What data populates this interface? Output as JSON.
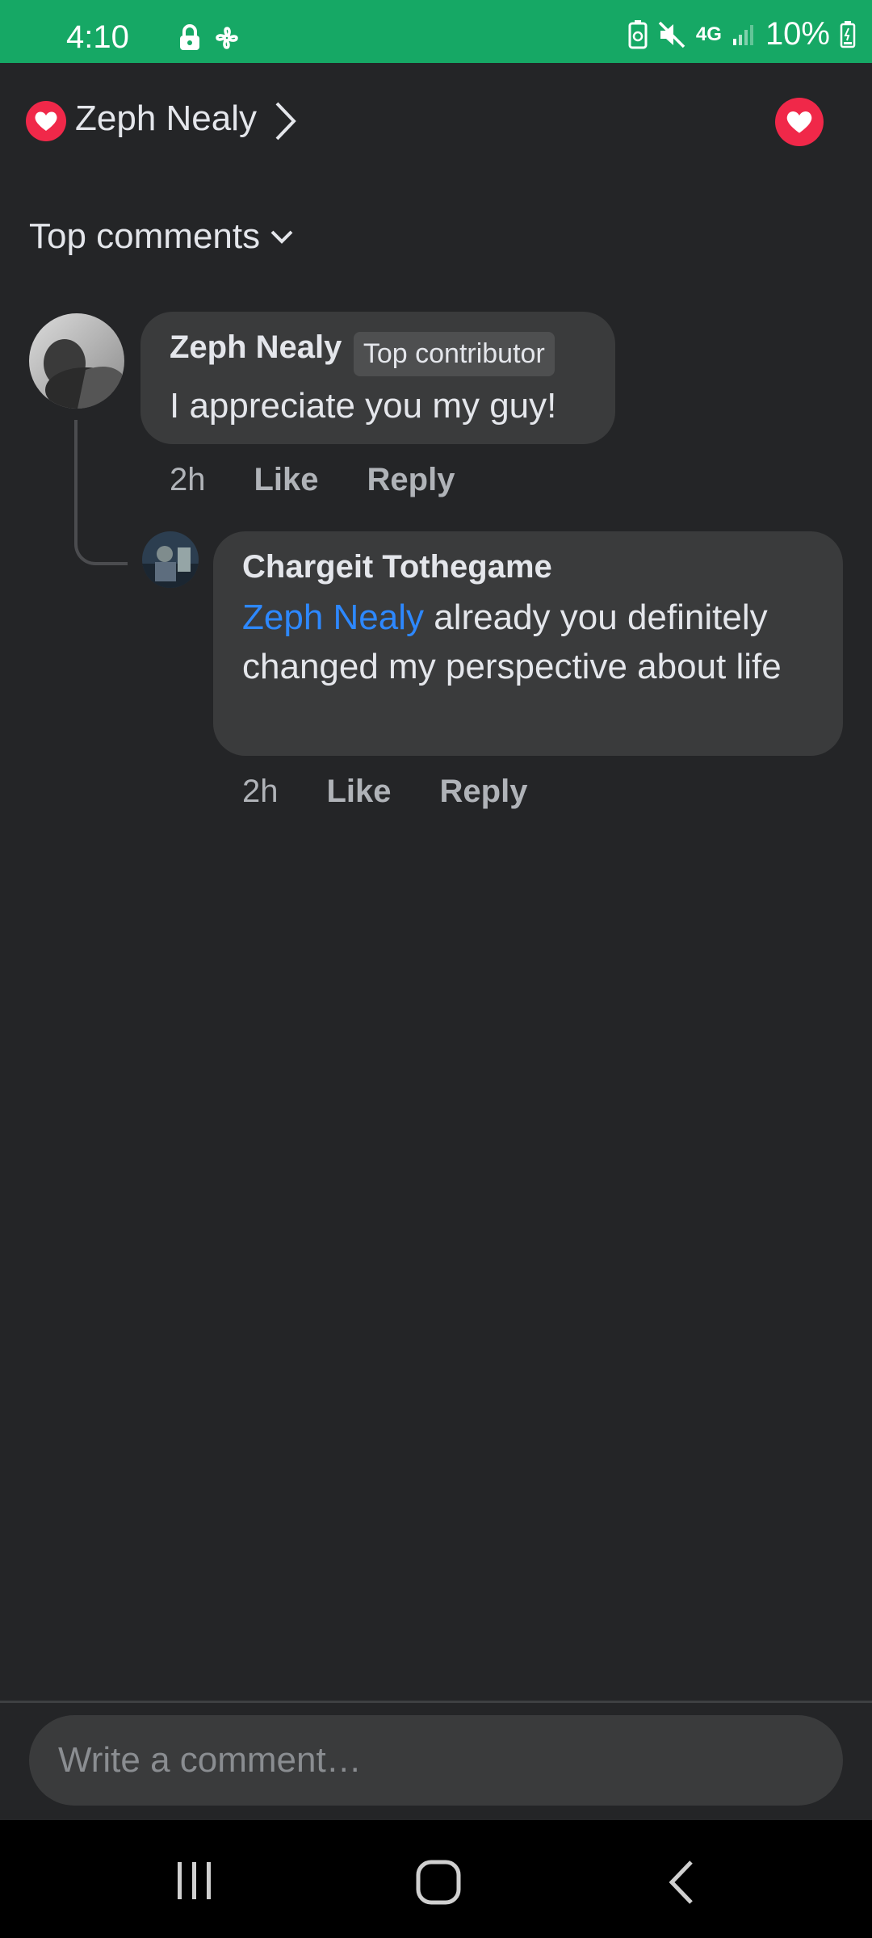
{
  "status_bar": {
    "time": "4:10",
    "network": "4G",
    "battery": "10%",
    "icons": [
      "lock-icon",
      "fan-icon",
      "recycle-battery-icon",
      "mute-icon",
      "4g-icon",
      "signal-icon",
      "battery-icon"
    ]
  },
  "header": {
    "name": "Zeph Nealy",
    "reaction": "heart",
    "accent": "#f02849"
  },
  "sort": {
    "label": "Top comments"
  },
  "comments": [
    {
      "author": "Zeph Nealy",
      "badge": "Top contributor",
      "text": "I appreciate you my guy!",
      "time": "2h",
      "like": "Like",
      "reply": "Reply"
    },
    {
      "author": "Chargeit Tothegame",
      "mention": "Zeph Nealy",
      "text": " already you definitely changed my perspective about life",
      "time": "2h",
      "like": "Like",
      "reply": "Reply"
    }
  ],
  "composer": {
    "placeholder": "Write a comment…"
  },
  "colors": {
    "status_bar": "#16a865",
    "background": "#242527",
    "bubble": "#3a3b3c",
    "mention": "#2d88ff"
  }
}
